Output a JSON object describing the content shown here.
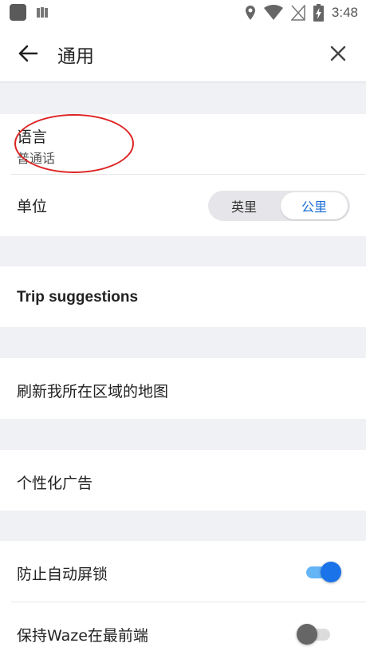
{
  "status_bar": {
    "time": "3:48",
    "icons": [
      "app-square-icon",
      "notification-icon",
      "location-icon",
      "wifi-icon",
      "no-sim-icon",
      "battery-charging-icon"
    ]
  },
  "app_bar": {
    "title": "通用",
    "back_icon": "back-arrow-icon",
    "close_icon": "close-icon"
  },
  "settings": {
    "language": {
      "label": "语言",
      "value": "普通话"
    },
    "units": {
      "label": "单位",
      "options": [
        "英里",
        "公里"
      ],
      "selected": "公里"
    },
    "trip_suggestions": {
      "label": "Trip suggestions"
    },
    "refresh_map": {
      "label": "刷新我所在区域的地图"
    },
    "personalized_ads": {
      "label": "个性化广告"
    },
    "prevent_autolock": {
      "label": "防止自动屏锁",
      "enabled": true
    },
    "keep_waze_on_top": {
      "label": "保持Waze在最前端",
      "enabled": false
    }
  },
  "colors": {
    "accent": "#1a73e8",
    "annotation": "#dd2222",
    "background": "#f0f1f5"
  }
}
